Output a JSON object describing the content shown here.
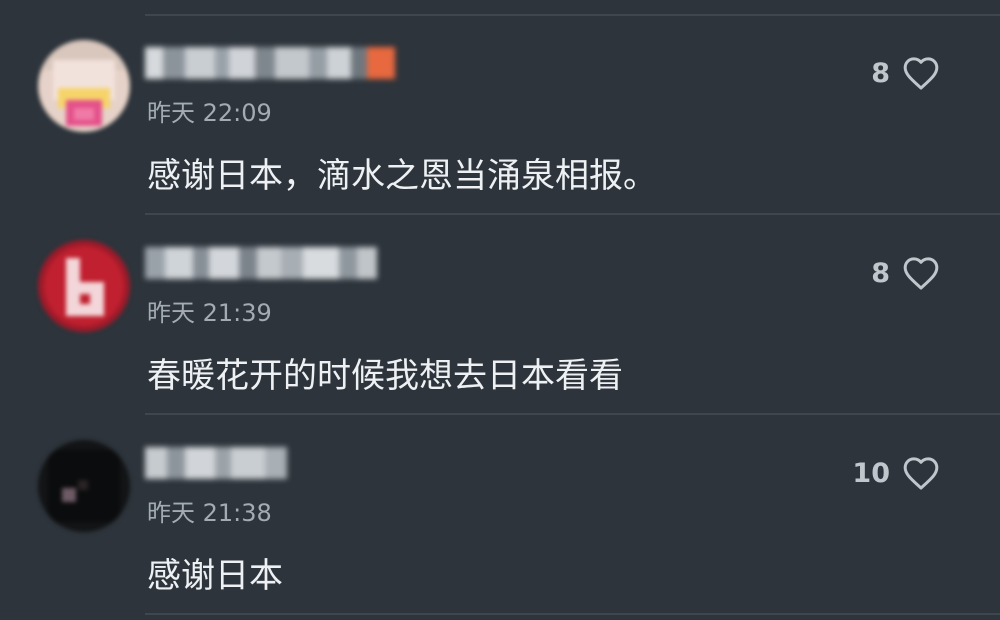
{
  "comments": [
    {
      "timestamp": "昨天 22:09",
      "content": "感谢日本，滴水之恩当涌泉相报。",
      "like_count": "8",
      "like_icon": "heart-outline-icon"
    },
    {
      "timestamp": "昨天 21:39",
      "content": "春暖花开的时候我想去日本看看",
      "like_count": "8",
      "like_icon": "heart-outline-icon"
    },
    {
      "timestamp": "昨天 21:38",
      "content": "感谢日本",
      "like_count": "10",
      "like_icon": "heart-outline-icon"
    }
  ],
  "colors": {
    "background": "#2d343b",
    "divider": "#3e464e",
    "timestamp": "#a3abb3",
    "text": "#eef1f4",
    "like": "#bfc6cc"
  }
}
